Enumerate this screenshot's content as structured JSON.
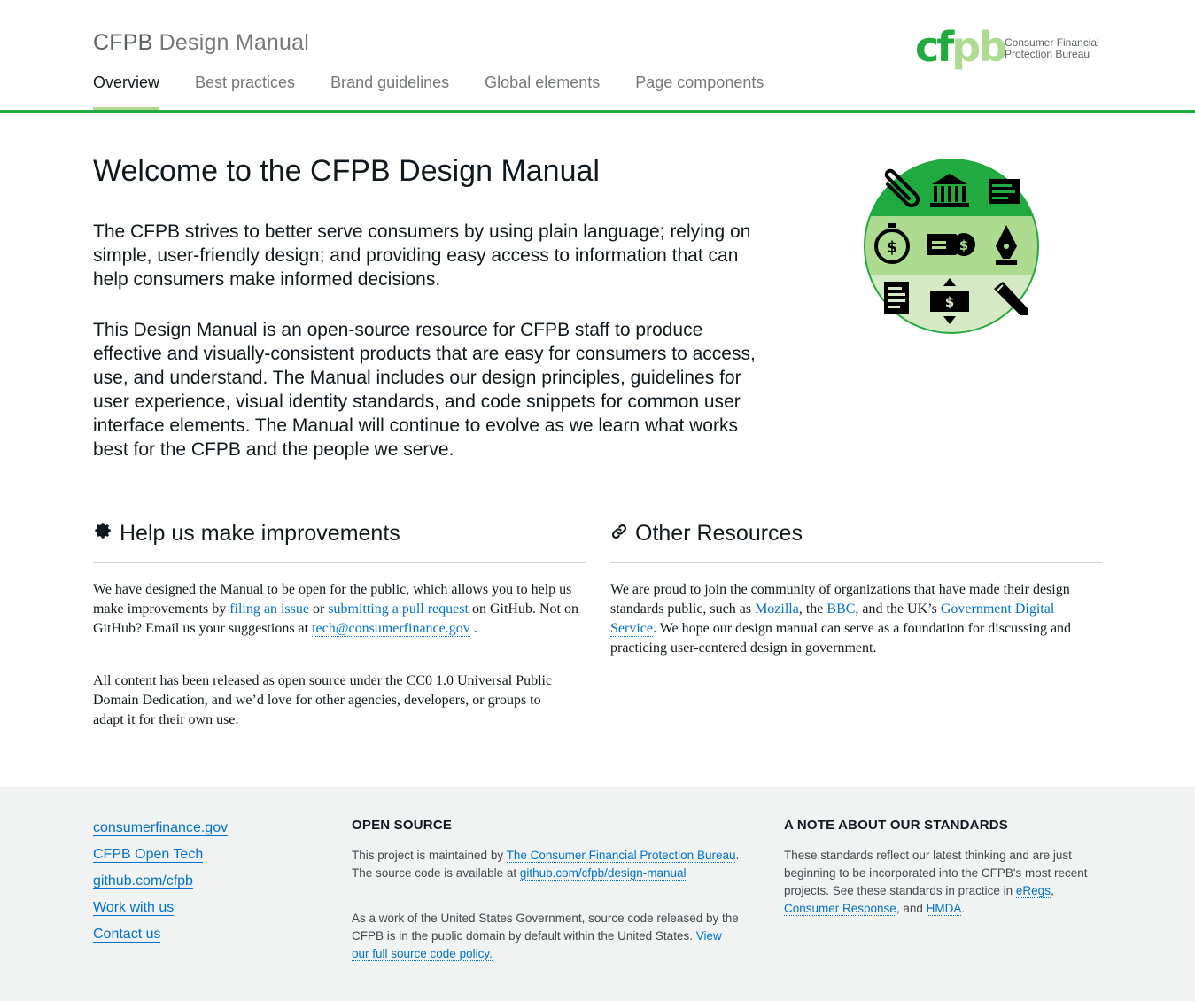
{
  "header": {
    "title_part1": "CFPB",
    "title_part2": "Design Manual",
    "nav": [
      {
        "label": "Overview"
      },
      {
        "label": "Best practices"
      },
      {
        "label": "Brand guidelines"
      },
      {
        "label": "Global elements"
      },
      {
        "label": "Page components"
      }
    ],
    "logo": {
      "mark_c": "c",
      "mark_f": "f",
      "mark_p": "p",
      "mark_b": "b",
      "line1": "Consumer Financial",
      "line2": "Protection Bureau"
    }
  },
  "main": {
    "heading": "Welcome to the CFPB Design Manual",
    "lead1": "The CFPB strives to better serve consumers by using plain language; relying on simple, user-friendly design; and providing easy access to information that can help consumers make informed decisions.",
    "lead2": "This Design Manual is an open-source resource for CFPB staff to produce effective and visually-consistent products that are easy for consumers to access, use, and understand. The Manual includes our design principles, guidelines for user experience, visual identity standards, and code snippets for common user interface elements. The Manual will continue to evolve as we learn what works best for the CFPB and the people we serve.",
    "hero_icons": [
      "paperclip-icon",
      "bank-icon",
      "document-icon",
      "stopwatch-dollar-icon",
      "money-icon",
      "pen-nib-icon",
      "form-icon",
      "transfer-dollar-icon",
      "pencil-icon"
    ]
  },
  "help": {
    "heading": "Help us make improvements",
    "p1_a": "We have designed the Manual to be open for the public, which allows you to help us make improvements by",
    "link_issue": "filing an issue",
    "p1_b": "or",
    "link_pr": "submitting a pull request",
    "p1_c": "on GitHub. Not on GitHub? Email us your suggestions at",
    "link_email": "tech@consumerfinance.gov",
    "p1_d": ".",
    "p2": "All content has been released as open source under the CC0 1.0 Universal Public Domain Dedication, and we’d love for other agencies, developers, or groups to adapt it for their own use."
  },
  "resources": {
    "heading": "Other Resources",
    "p_a": "We are proud to join the community of organizations that have made their design standards public, such as",
    "link_mozilla": "Mozilla",
    "p_b": ", the",
    "link_bbc": "BBC",
    "p_c": ", and the UK’s",
    "link_gds": "Government Digital Service",
    "p_d": ". We hope our design manual can serve as a foundation for discussing and practicing user-centered design in government."
  },
  "footer": {
    "links": [
      {
        "label": "consumerfinance.gov"
      },
      {
        "label": "CFPB Open Tech"
      },
      {
        "label": "github.com/cfpb"
      },
      {
        "label": "Work with us"
      },
      {
        "label": "Contact us"
      }
    ],
    "open_source": {
      "heading": "OPEN SOURCE",
      "p1_a": "This project is maintained by",
      "link_bureau": "The Consumer Financial Protection Bureau",
      "p1_b": ". The source code is available at",
      "link_repo": "github.com/cfpb/design-manual",
      "p2_a": "As a work of the United States Government, source code released by the CFPB is in the public domain by default within the United States.",
      "link_policy": "View our full source code policy."
    },
    "standards": {
      "heading": "A NOTE ABOUT OUR STANDARDS",
      "p_a": "These standards reflect our latest thinking and are just beginning to be incorporated into the CFPB's most recent projects. See these standards in practice in",
      "link_eregs": "eRegs",
      "p_b": ",",
      "link_cr": "Consumer Response",
      "p_c": ", and",
      "link_hmda": "HMDA",
      "p_d": "."
    }
  },
  "colors": {
    "brand_green": "#20aa3f",
    "light_green": "#addc91",
    "pale_green": "#d4e9c4",
    "link_blue": "#0072ce",
    "footer_bg": "#f1f2f2"
  }
}
